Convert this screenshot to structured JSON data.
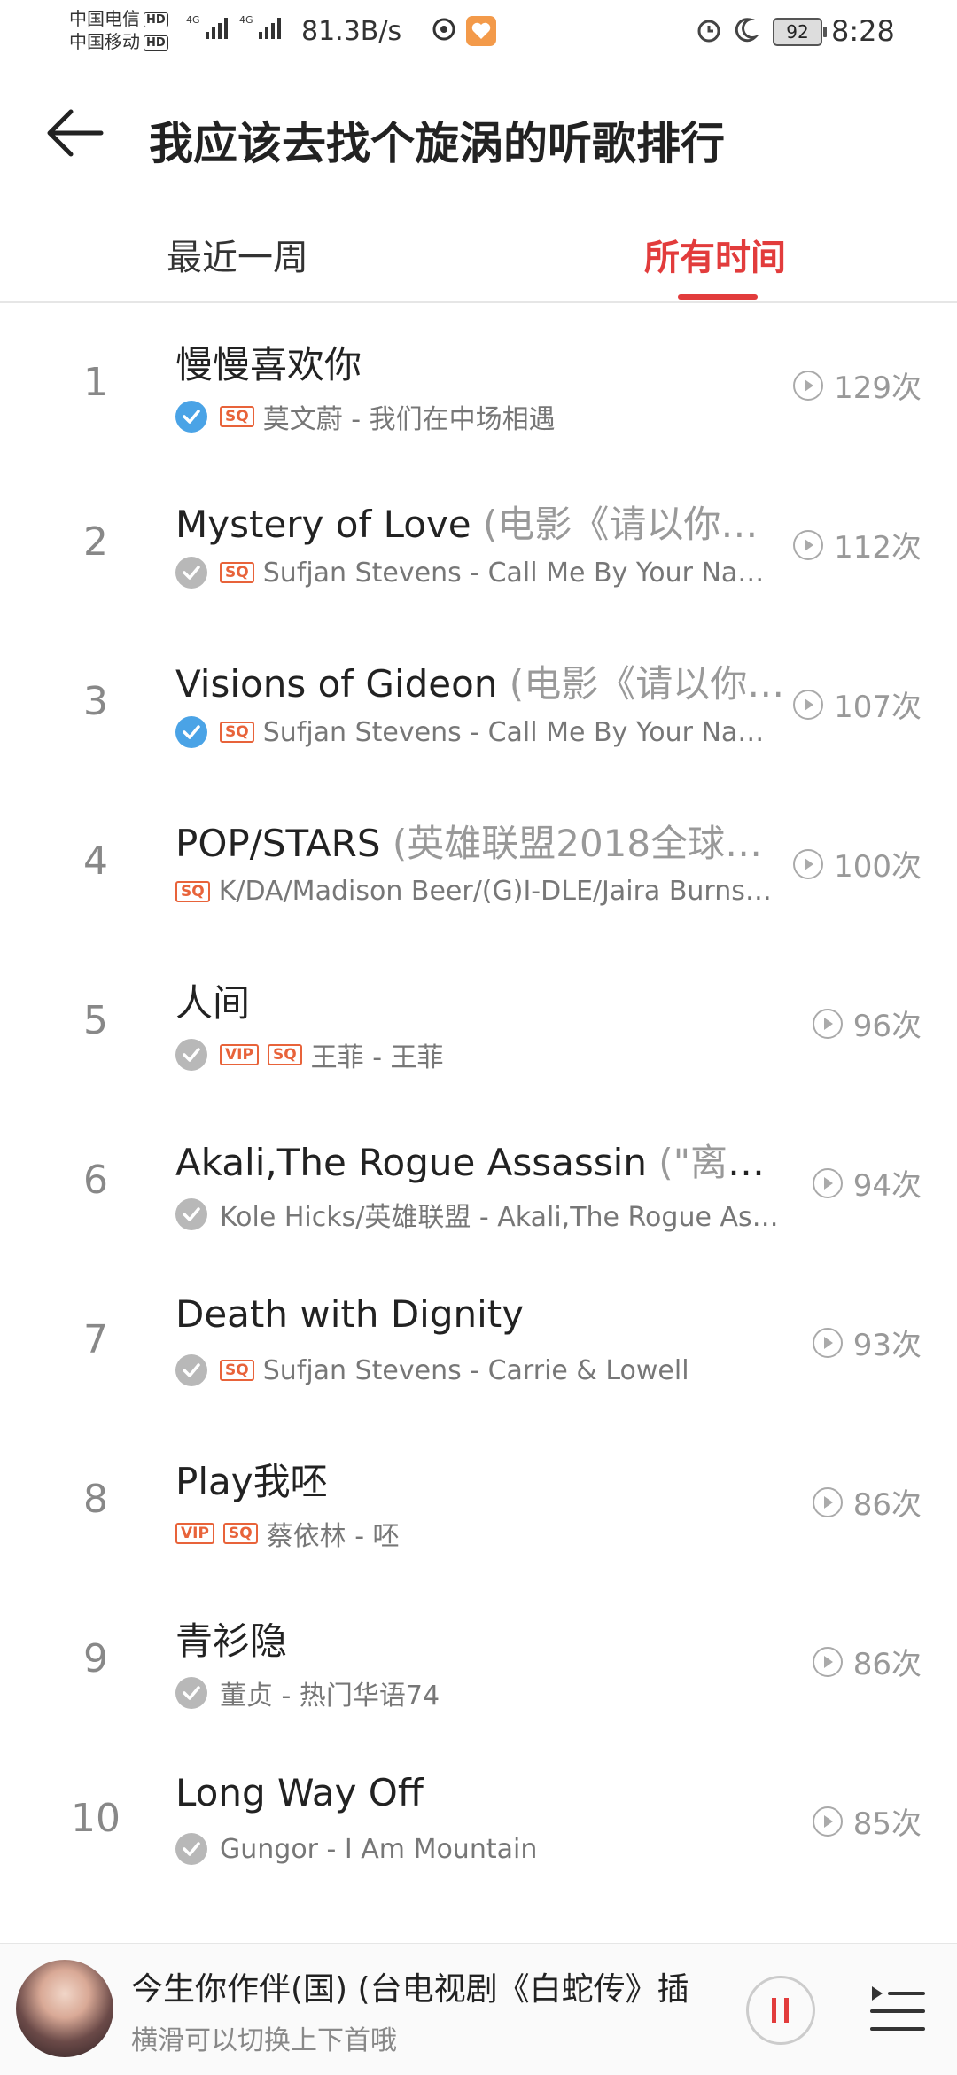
{
  "status_bar": {
    "carrier1": "中国电信",
    "carrier2": "中国移动",
    "hd": "HD",
    "net_type": "4G",
    "net_speed": "81.3B/s",
    "battery": "92",
    "time": "8:28"
  },
  "header": {
    "title": "我应该去找个旋涡的听歌排行"
  },
  "tabs": [
    {
      "label": "最近一周"
    },
    {
      "label": "所有时间",
      "active": true
    }
  ],
  "songs": [
    {
      "rank": "1",
      "title": "慢慢喜欢你",
      "subtitle": "",
      "check": "blue",
      "badges": [
        "SQ"
      ],
      "meta": "莫文蔚 - 我们在中场相遇",
      "plays": "129次"
    },
    {
      "rank": "2",
      "title": "Mystery of Love",
      "subtitle": " (电影《请以你…",
      "check": "gray",
      "badges": [
        "SQ"
      ],
      "meta": "Sufjan Stevens - Call Me By Your Nam…",
      "plays": "112次"
    },
    {
      "rank": "3",
      "title": "Visions of Gideon",
      "subtitle": " (电影《请以你…",
      "check": "blue",
      "badges": [
        "SQ"
      ],
      "meta": "Sufjan Stevens - Call Me By Your Nam…",
      "plays": "107次"
    },
    {
      "rank": "4",
      "title": "POP/STARS",
      "subtitle": " (英雄联盟2018全球…",
      "check": "",
      "badges": [
        "SQ"
      ],
      "meta": "K/DA/Madison Beer/(G)I-DLE/Jaira Burns…",
      "plays": "100次"
    },
    {
      "rank": "5",
      "title": "人间",
      "subtitle": "",
      "check": "gray",
      "badges": [
        "VIP",
        "SQ"
      ],
      "meta": "王菲 - 王菲",
      "plays": "96次"
    },
    {
      "rank": "6",
      "title": "Akali,The Rogue Assassin",
      "subtitle": " (\"离群…",
      "check": "gray",
      "badges": [],
      "meta": "Kole Hicks/英雄联盟 - Akali,The Rogue As…",
      "plays": "94次"
    },
    {
      "rank": "7",
      "title": "Death with Dignity",
      "subtitle": "",
      "check": "gray",
      "badges": [
        "SQ"
      ],
      "meta": "Sufjan Stevens - Carrie & Lowell",
      "plays": "93次"
    },
    {
      "rank": "8",
      "title": "Play我呸",
      "subtitle": "",
      "check": "",
      "badges": [
        "VIP",
        "SQ"
      ],
      "meta": "蔡依林 - 呸",
      "plays": "86次"
    },
    {
      "rank": "9",
      "title": "青衫隐",
      "subtitle": "",
      "check": "gray",
      "badges": [],
      "meta": "董贞 - 热门华语74",
      "plays": "86次"
    },
    {
      "rank": "10",
      "title": "Long Way Off",
      "subtitle": "",
      "check": "gray",
      "badges": [],
      "meta": "Gungor - I Am Mountain",
      "plays": "85次"
    }
  ],
  "player": {
    "title": "今生你作伴(国) (台电视剧《白蛇传》插",
    "hint": "横滑可以切换上下首哦"
  },
  "colors": {
    "accent": "#e23c3c",
    "badge": "#e8633a",
    "check_blue": "#4aa3e6"
  }
}
